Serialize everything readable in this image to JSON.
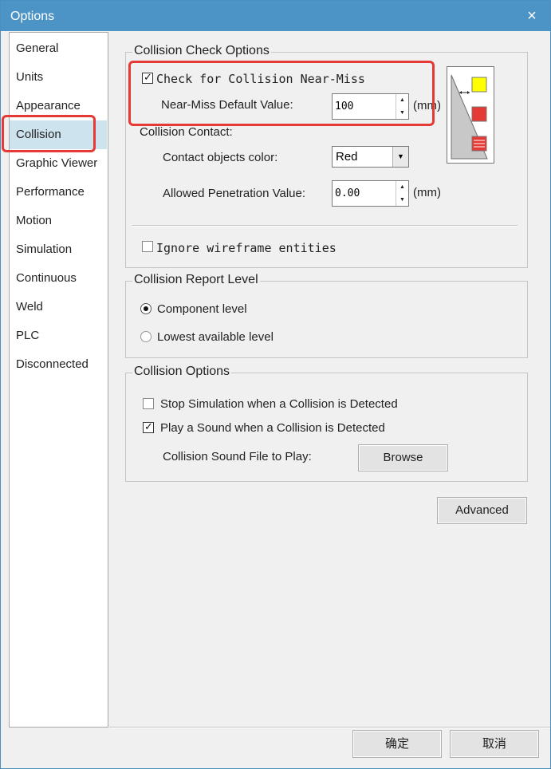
{
  "window": {
    "title": "Options"
  },
  "nav": {
    "items": [
      {
        "label": "General"
      },
      {
        "label": "Units"
      },
      {
        "label": "Appearance"
      },
      {
        "label": "Collision"
      },
      {
        "label": "Graphic Viewer"
      },
      {
        "label": "Performance"
      },
      {
        "label": "Motion"
      },
      {
        "label": "Simulation"
      },
      {
        "label": "Continuous"
      },
      {
        "label": "Weld"
      },
      {
        "label": "PLC"
      },
      {
        "label": "Disconnected"
      }
    ],
    "selected": "Collision"
  },
  "collision_check": {
    "title": "Collision Check Options",
    "near_miss_checkbox": {
      "label": "Check for Collision Near-Miss",
      "checked": true
    },
    "near_miss_default": {
      "label": "Near-Miss Default Value:",
      "value": "100",
      "unit": "(mm)"
    },
    "contact_heading": "Collision Contact:",
    "contact_color": {
      "label": "Contact objects color:",
      "value": "Red"
    },
    "penetration": {
      "label": "Allowed Penetration Value:",
      "value": "0.00",
      "unit": "(mm)"
    },
    "ignore_wireframe": {
      "label": "Ignore wireframe entities",
      "checked": false
    },
    "preview_colors": {
      "near_miss": "#ffff00",
      "contact": "#e53935",
      "penetration": "#e53935"
    }
  },
  "report_level": {
    "title": "Collision Report Level",
    "options": [
      {
        "label": "Component level",
        "selected": true
      },
      {
        "label": "Lowest available level",
        "selected": false
      }
    ]
  },
  "collision_options": {
    "title": "Collision Options",
    "stop_simulation": {
      "label": "Stop Simulation when a Collision is Detected",
      "checked": false
    },
    "play_sound": {
      "label": "Play a Sound when a Collision is Detected",
      "checked": true
    },
    "sound_file_label": "Collision Sound File to Play:",
    "browse_label": "Browse"
  },
  "advanced_label": "Advanced",
  "footer": {
    "ok_label": "确定",
    "cancel_label": "取消"
  },
  "icons": {
    "close": "×",
    "checkmark": "✓",
    "spin_up": "▲",
    "spin_down": "▼",
    "dropdown": "▼",
    "double_arrow": "↔"
  },
  "colors": {
    "titlebar": "#4d94c6",
    "selection": "#cde3ee",
    "annotation": "#e53935"
  }
}
